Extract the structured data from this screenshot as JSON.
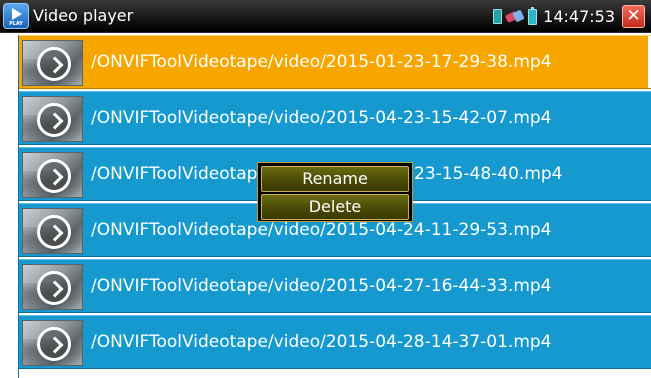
{
  "titlebar": {
    "app_icon_text": "PLAY",
    "title": "Video player",
    "clock": "14:47:53",
    "close_symbol": "✕",
    "icons": [
      "sd-card-icon",
      "usb-icon",
      "battery-icon",
      "close-icon"
    ]
  },
  "file_list": {
    "selected_index": 0,
    "items": [
      {
        "path": "/ONVIFToolVideotape/video/2015-01-23-17-29-38.mp4"
      },
      {
        "path": "/ONVIFToolVideotape/video/2015-04-23-15-42-07.mp4"
      },
      {
        "path": "/ONVIFToolVideotap"
      },
      {
        "path": "/ONVIFToolVideotape/video/2015-04-24-11-29-53.mp4"
      },
      {
        "path": "/ONVIFToolVideotape/video/2015-04-27-16-44-33.mp4"
      },
      {
        "path": "/ONVIFToolVideotape/video/2015-04-28-14-37-01.mp4"
      }
    ],
    "row3_tail": "23-15-48-40.mp4"
  },
  "context_menu": {
    "items": [
      "Rename",
      "Delete"
    ]
  },
  "colors": {
    "row_background": "#1699cf",
    "selected_row_background": "#f7a600",
    "titlebar_background": "#000000",
    "menu_button": "#4a4a06",
    "close_button": "#c5291c"
  }
}
